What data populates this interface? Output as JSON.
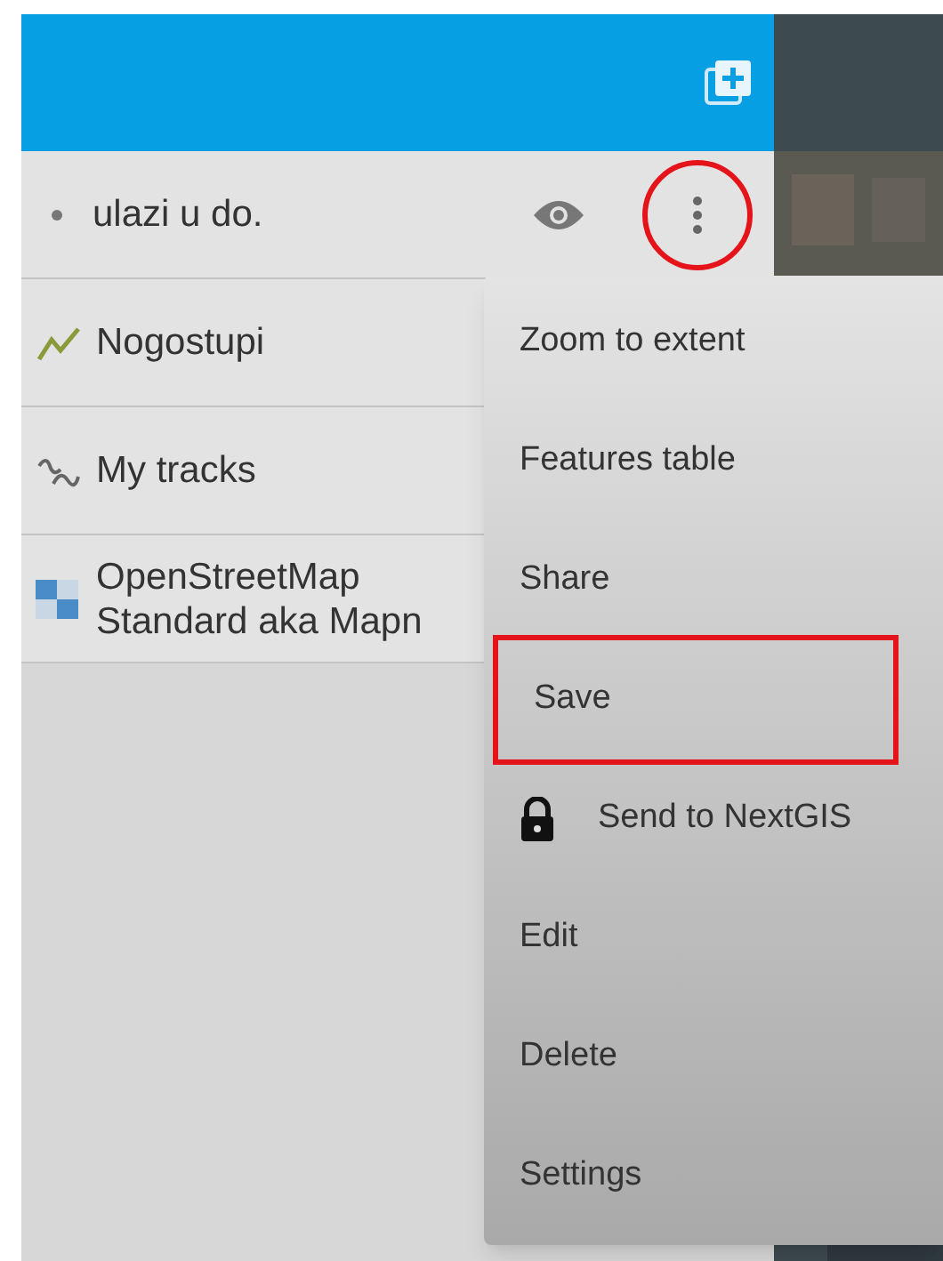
{
  "layers": [
    {
      "name": "ulazi u do.",
      "kind": "dot",
      "visible": true,
      "menu_highlighted": true
    },
    {
      "name": "Nogostupi",
      "kind": "line"
    },
    {
      "name": "My tracks",
      "kind": "track"
    },
    {
      "name": "OpenStreetMap\nStandard aka Mapn",
      "kind": "tiles"
    }
  ],
  "menu": [
    {
      "label": "Zoom to extent",
      "locked": false,
      "highlighted": false
    },
    {
      "label": "Features table",
      "locked": false,
      "highlighted": false
    },
    {
      "label": "Share",
      "locked": false,
      "highlighted": false
    },
    {
      "label": "Save",
      "locked": false,
      "highlighted": true
    },
    {
      "label": "Send to NextGIS",
      "locked": true,
      "highlighted": false
    },
    {
      "label": "Edit",
      "locked": false,
      "highlighted": false
    },
    {
      "label": "Delete",
      "locked": false,
      "highlighted": false
    },
    {
      "label": "Settings",
      "locked": false,
      "highlighted": false
    }
  ]
}
